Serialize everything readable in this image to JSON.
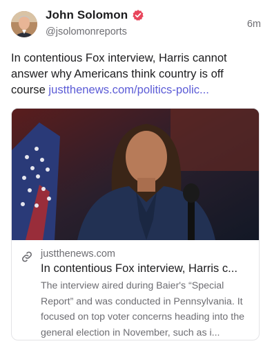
{
  "author": {
    "name": "John Solomon",
    "handle": "@jsolomonreports"
  },
  "post": {
    "time": "6m",
    "text": "In contentious Fox interview, Harris cannot answer why Americans think country is off course ",
    "link_text": "justthenews.com/politics-polic..."
  },
  "link_card": {
    "domain": "justthenews.com",
    "title": "In contentious Fox interview, Harris c...",
    "description": "The interview aired during Baier's “Special Report” and was conducted in Pennsylvania. It focused on top voter concerns heading into the general election in November, such as i..."
  },
  "icons": {
    "verified": "verified-badge-icon",
    "link": "link-icon"
  },
  "colors": {
    "link": "#5b5bd6",
    "verified": "#e8455b",
    "secondary_text": "#6d6d72"
  }
}
